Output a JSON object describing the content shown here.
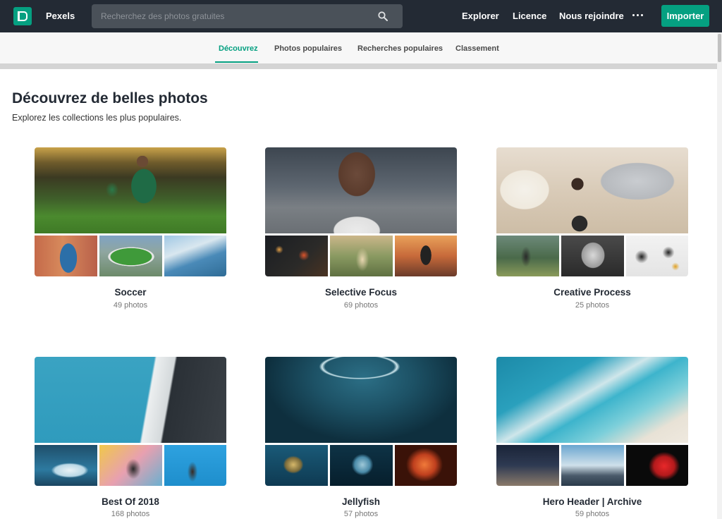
{
  "header": {
    "brand": "Pexels",
    "search_placeholder": "Recherchez des photos gratuites",
    "nav": [
      "Explorer",
      "Licence",
      "Nous rejoindre"
    ],
    "import_label": "Importer"
  },
  "tabs": [
    "Découvrez",
    "Photos populaires",
    "Recherches populaires",
    "Classement"
  ],
  "active_tab": "Découvrez",
  "page": {
    "title": "Découvrez de belles photos",
    "subtitle": "Explorez les collections les plus populaires."
  },
  "collections": [
    {
      "title": "Soccer",
      "count": "49 photos"
    },
    {
      "title": "Selective Focus",
      "count": "69 photos"
    },
    {
      "title": "Creative Process",
      "count": "25 photos"
    },
    {
      "title": "Best Of 2018",
      "count": "168 photos"
    },
    {
      "title": "Jellyfish",
      "count": "57 photos"
    },
    {
      "title": "Hero Header | Archive",
      "count": "59 photos"
    }
  ],
  "colors": {
    "accent": "#05a081",
    "topbar": "#232a34"
  }
}
